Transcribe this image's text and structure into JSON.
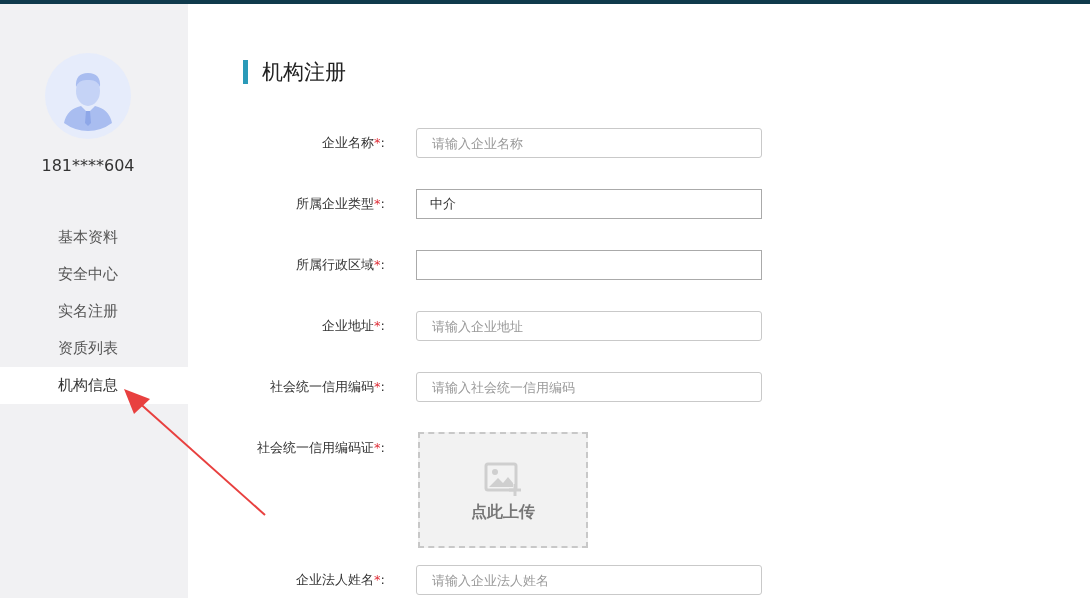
{
  "sidebar": {
    "user": {
      "phone": "181****604"
    },
    "items": [
      {
        "label": "基本资料",
        "selected": false
      },
      {
        "label": "安全中心",
        "selected": false
      },
      {
        "label": "实名注册",
        "selected": false
      },
      {
        "label": "资质列表",
        "selected": false
      },
      {
        "label": "机构信息",
        "selected": true
      }
    ]
  },
  "page_title": "机构注册",
  "fields": [
    {
      "kind": "input",
      "label": "企业名称",
      "mark": "*",
      "colon": ":",
      "placeholder": "请输入企业名称"
    },
    {
      "kind": "input",
      "label": "所属企业类型",
      "mark": "*",
      "colon": ":",
      "value": "中介"
    },
    {
      "kind": "input",
      "label": "所属行政区域",
      "mark": "*",
      "colon": ":"
    },
    {
      "kind": "input",
      "label": "企业地址",
      "mark": "*",
      "colon": ":",
      "placeholder": "请输入企业地址"
    },
    {
      "kind": "input",
      "label": "社会统一信用编码",
      "mark": "*",
      "colon": ":",
      "placeholder": "请输入社会统一信用编码"
    },
    {
      "kind": "upload",
      "label": "社会统一信用编码证",
      "mark": "*",
      "colon": ":",
      "button": "点此上传"
    },
    {
      "kind": "input",
      "label": "企业法人姓名",
      "mark": "*",
      "colon": ":",
      "placeholder": "请输入企业法人姓名"
    }
  ]
}
